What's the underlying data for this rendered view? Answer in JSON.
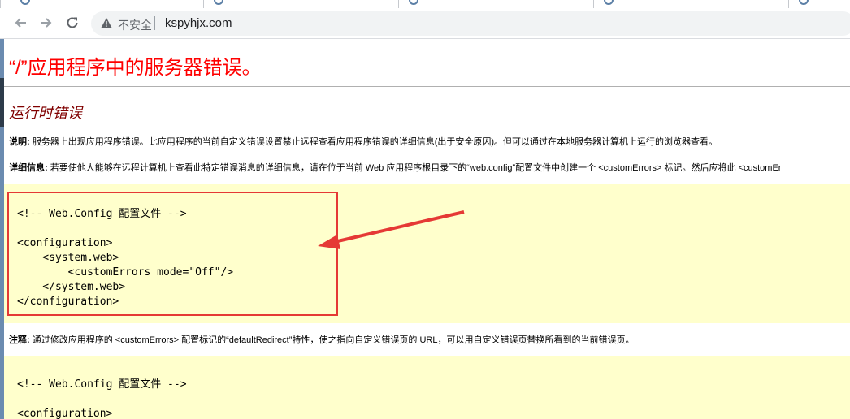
{
  "browser": {
    "security_label": "不安全",
    "url": "kspyhjx.com"
  },
  "page": {
    "title": "“/”应用程序中的服务器错误。",
    "subtitle": "运行时错误",
    "description": {
      "label": "说明:",
      "text": " 服务器上出现应用程序错误。此应用程序的当前自定义错误设置禁止远程查看应用程序错误的详细信息(出于安全原因)。但可以通过在本地服务器计算机上运行的浏览器查看。"
    },
    "details": {
      "label": "详细信息:",
      "text": " 若要使他人能够在远程计算机上查看此特定错误消息的详细信息，请在位于当前 Web 应用程序根目录下的“web.config”配置文件中创建一个 <customErrors> 标记。然后应将此 <customEr"
    },
    "code1": {
      "comment": "<!-- Web.Config 配置文件 -->",
      "line1": "<configuration>",
      "line2": "    <system.web>",
      "line3": "        <customErrors mode=\"Off\"/>",
      "line4": "    </system.web>",
      "line5": "</configuration>"
    },
    "note": {
      "label": "注释:",
      "text": " 通过修改应用程序的 <customErrors> 配置标记的“defaultRedirect”特性，使之指向自定义错误页的 URL，可以用自定义错误页替换所看到的当前错误页。"
    },
    "code2": {
      "comment": "<!-- Web.Config 配置文件 -->",
      "line1": "<configuration>"
    }
  },
  "colors": {
    "title": "#ff0000",
    "subtitle": "#800000",
    "code_background": "#ffffcc",
    "annotation": "#e53935"
  }
}
